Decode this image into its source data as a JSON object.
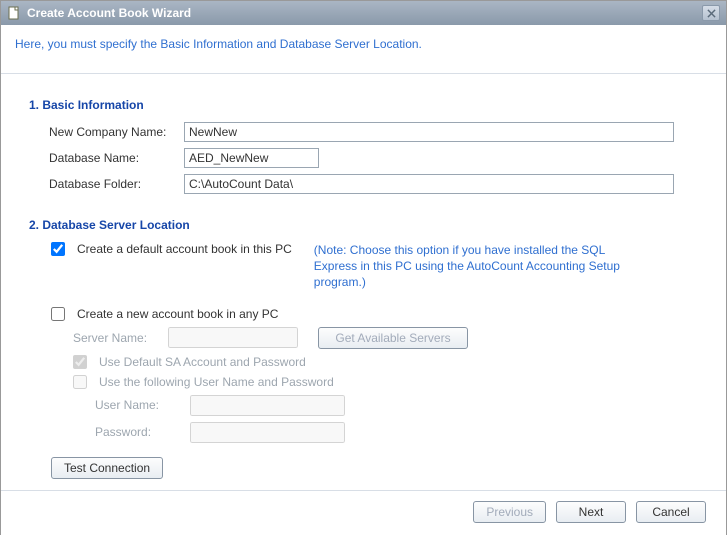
{
  "window": {
    "title": "Create Account Book Wizard"
  },
  "instruction": "Here, you must specify the Basic Information and Database Server Location.",
  "sections": {
    "basic": {
      "heading": "1. Basic Information",
      "company_label": "New Company Name:",
      "company_value": "NewNew",
      "dbname_label": "Database Name:",
      "dbname_value": "AED_NewNew",
      "dbfolder_label": "Database Folder:",
      "dbfolder_value": "C:\\AutoCount Data\\"
    },
    "server": {
      "heading": "2. Database Server Location",
      "create_default_label": "Create a default account book in this PC",
      "note": "(Note: Choose this option if you have installed the SQL Express in this PC using the AutoCount Accounting Setup program.)",
      "create_anypc_label": "Create a new account book in any PC",
      "servername_label": "Server Name:",
      "servername_value": "",
      "get_servers_label": "Get Available Servers",
      "use_default_sa_label": "Use Default SA Account and Password",
      "use_following_label": "Use the following User Name and Password",
      "username_label": "User Name:",
      "username_value": "",
      "password_label": "Password:",
      "password_value": "",
      "test_connection_label": "Test Connection"
    }
  },
  "footer": {
    "previous": "Previous",
    "next": "Next",
    "cancel": "Cancel"
  }
}
